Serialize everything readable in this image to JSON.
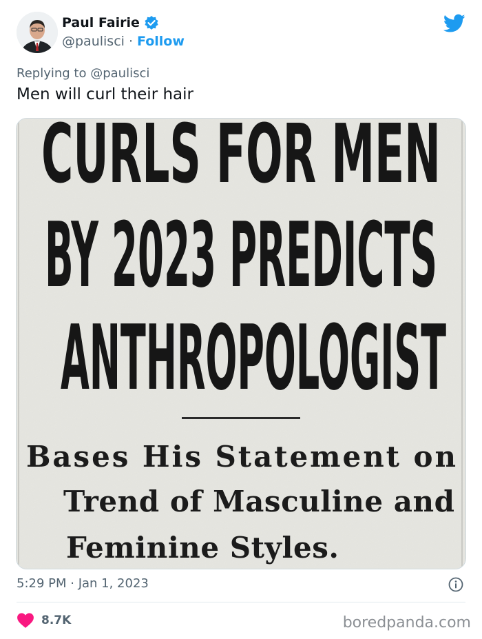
{
  "author": {
    "name": "Paul Fairie",
    "handle": "@paulisci",
    "separator": "·",
    "follow_label": "Follow"
  },
  "reply": {
    "prefix": "Replying to",
    "mention": "@paulisci"
  },
  "tweet": {
    "text": "Men will curl their hair",
    "timestamp": "5:29 PM · Jan 1, 2023",
    "like_count": "8.7K"
  },
  "media": {
    "headline_lines": [
      "CURLS FOR MEN",
      "BY 2023 PREDICTS",
      "ANTHROPOLOGIST"
    ],
    "subhead_lines": [
      "Bases His Statement on",
      "Trend of Masculine and",
      "Feminine Styles."
    ]
  },
  "watermark": "boredpanda.com",
  "colors": {
    "accent": "#1d9bf0",
    "heart": "#f91880",
    "secondary_text": "#536471"
  },
  "icons": {
    "verified": "verified-badge-icon",
    "twitter": "twitter-bird-icon",
    "info": "info-icon",
    "heart": "heart-icon"
  }
}
